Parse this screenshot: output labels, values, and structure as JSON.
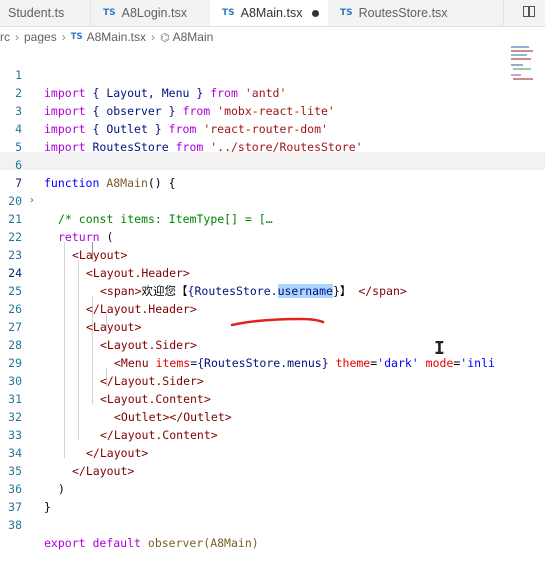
{
  "tabs": [
    {
      "label": "Student.ts",
      "active": false
    },
    {
      "label": "A8Login.tsx",
      "icon": "TS",
      "active": false
    },
    {
      "label": "A8Main.tsx",
      "icon": "TS",
      "active": true,
      "modified": true
    },
    {
      "label": "RoutesStore.tsx",
      "icon": "TS",
      "active": false
    }
  ],
  "breadcrumb": {
    "parts": [
      "rc",
      "pages",
      "A8Main.tsx",
      "A8Main"
    ],
    "file_icon": "TS"
  },
  "line_numbers": [
    "1",
    "2",
    "3",
    "4",
    "5",
    "6",
    "7",
    "20",
    "21",
    "22",
    "23",
    "24",
    "25",
    "26",
    "27",
    "28",
    "29",
    "30",
    "31",
    "32",
    "33",
    "34",
    "35",
    "36",
    "37",
    "38"
  ],
  "code": {
    "import_kw": "import",
    "from_kw": "from",
    "line1_names": "{ Layout, Menu }",
    "line1_module": "'antd'",
    "line2_names": "{ observer }",
    "line2_module": "'mobx-react-lite'",
    "line3_names": "{ Outlet }",
    "line3_module": "'react-router-dom'",
    "line4_name": "RoutesStore",
    "line4_module": "'../store/RoutesStore'",
    "function_kw": "function",
    "fn_name": "A8Main",
    "fn_sig_rest": "() {",
    "folded_comment": "/* const items: ItemType[] = [",
    "folded_ellipsis": "…",
    "return_kw": "return",
    "open_paren": "(",
    "layout_open": "<Layout>",
    "header_open": "<Layout.Header>",
    "span_open": "<span>",
    "welcome_text": "欢迎您【",
    "expr_open": "{RoutesStore.",
    "username": "username",
    "expr_close": "}",
    "bracket_close": "】",
    "span_close": "</span>",
    "header_close": "</Layout.Header>",
    "layout_open2": "<Layout>",
    "sider_open": "<Layout.Sider>",
    "menu_tag": "<Menu",
    "menu_items_attr": "items",
    "menu_items_val": "={RoutesStore.menus}",
    "menu_theme_attr": "theme",
    "menu_theme_val": "'dark'",
    "menu_mode_attr": "mode",
    "menu_mode_val": "'inli",
    "sider_close": "</Layout.Sider>",
    "content_open": "<Layout.Content>",
    "outlet": "<Outlet></Outlet>",
    "content_close": "</Layout.Content>",
    "layout_close": "</Layout>",
    "layout_close2": "</Layout>",
    "paren_close": ")",
    "brace_close": "}",
    "export_kw": "export",
    "default_kw": "default",
    "export_call": "observer(A8Main)"
  },
  "colors": {
    "annotation_underline": "#e0231f",
    "selection": "#add6ff"
  }
}
